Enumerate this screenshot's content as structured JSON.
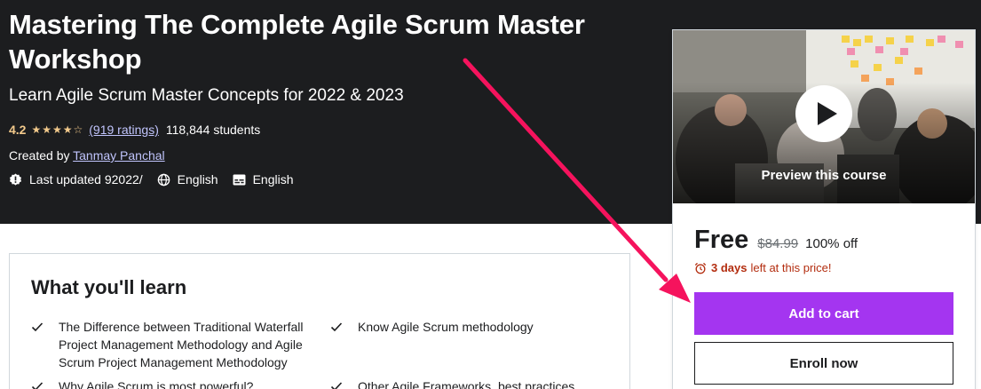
{
  "course": {
    "title": "Mastering The Complete Agile Scrum Master Workshop",
    "subtitle": "Learn Agile Scrum Master Concepts for 2022 & 2023",
    "rating": "4.2",
    "rating_value": 4.2,
    "stars_text": "★★★★☆",
    "ratings_count": "(919 ratings)",
    "students": "118,844 students",
    "created_by_label": "Created by",
    "instructor": "Tanmay Panchal",
    "last_updated": "Last updated 92022/",
    "language": "English",
    "captions": "English"
  },
  "sidebar": {
    "preview_label": "Preview this course",
    "price": "Free",
    "original_price": "$84.99",
    "discount": "100% off",
    "timer_days": "3 days",
    "timer_text": "left at this price!",
    "add_to_cart": "Add to cart",
    "enroll_now": "Enroll now"
  },
  "learn": {
    "title": "What you'll learn",
    "items": [
      "The Difference between Traditional Waterfall Project Management Methodology and Agile Scrum Project Management Methodology",
      "Know Agile Scrum methodology",
      "Why Agile Scrum is most powerful?",
      "Other Agile Frameworks, best practices."
    ]
  },
  "colors": {
    "hero_bg": "#1c1d1f",
    "accent_purple": "#a435f0",
    "rating_gold": "#f3ca8c",
    "link_lavender": "#c0c4fc",
    "timer_red": "#b32d0f",
    "annotation_arrow": "#f5135d"
  },
  "icons": [
    "star-icon",
    "alert-badge-icon",
    "globe-icon",
    "captions-icon",
    "play-icon",
    "alarm-clock-icon",
    "checkmark-icon"
  ]
}
